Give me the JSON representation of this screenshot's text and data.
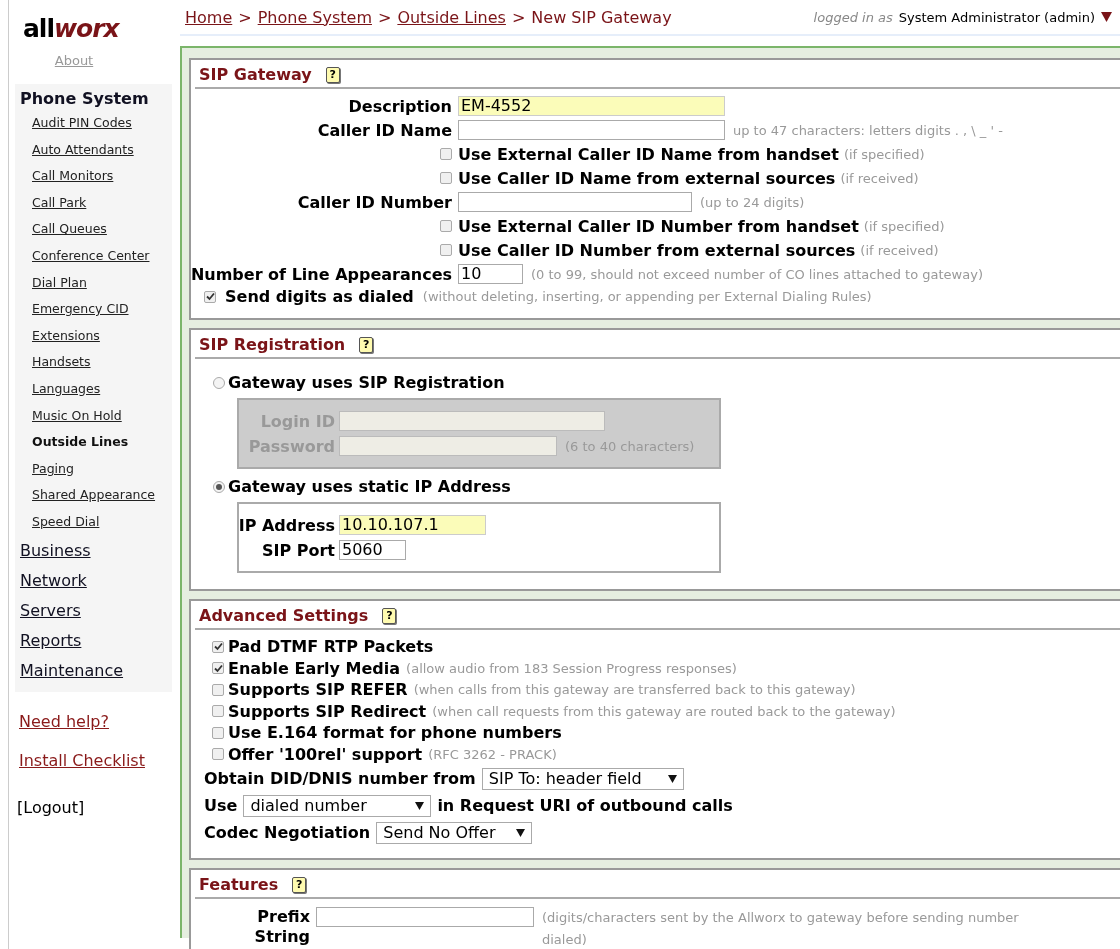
{
  "logo": {
    "dark": "all",
    "accent": "worx"
  },
  "about": "About",
  "sidebar": {
    "groups": [
      {
        "label": "Phone System",
        "expanded": true,
        "children": [
          {
            "label": "Audit PIN Codes",
            "selected": false
          },
          {
            "label": "Auto Attendants",
            "selected": false
          },
          {
            "label": "Call Monitors",
            "selected": false
          },
          {
            "label": "Call Park",
            "selected": false
          },
          {
            "label": "Call Queues",
            "selected": false
          },
          {
            "label": "Conference Center",
            "selected": false
          },
          {
            "label": "Dial Plan",
            "selected": false
          },
          {
            "label": "Emergency CID",
            "selected": false
          },
          {
            "label": "Extensions",
            "selected": false
          },
          {
            "label": "Handsets",
            "selected": false
          },
          {
            "label": "Languages",
            "selected": false
          },
          {
            "label": "Music On Hold",
            "selected": false
          },
          {
            "label": "Outside Lines",
            "selected": true
          },
          {
            "label": "Paging",
            "selected": false
          },
          {
            "label": "Shared Appearance",
            "selected": false
          },
          {
            "label": "Speed Dial",
            "selected": false
          }
        ]
      },
      {
        "label": "Business",
        "expanded": false
      },
      {
        "label": "Network",
        "expanded": false
      },
      {
        "label": "Servers",
        "expanded": false
      },
      {
        "label": "Reports",
        "expanded": false
      },
      {
        "label": "Maintenance",
        "expanded": false
      }
    ],
    "links": [
      "Need help?",
      "Install Checklist"
    ],
    "logout": "[Logout]"
  },
  "breadcrumb": [
    {
      "kind": "link",
      "text": "Home"
    },
    {
      "kind": "separator",
      "text": ">"
    },
    {
      "kind": "link",
      "text": "Phone System"
    },
    {
      "kind": "separator",
      "text": ">"
    },
    {
      "kind": "link",
      "text": "Outside Lines"
    },
    {
      "kind": "separator",
      "text": ">"
    },
    {
      "kind": "current",
      "text": "New SIP Gateway"
    }
  ],
  "user": {
    "prefix": "logged in as",
    "name": "System Administrator (admin)"
  },
  "sections": [
    {
      "title": "SIP Gateway",
      "help": "?",
      "rows": [
        {
          "kind": "field",
          "label": "Description",
          "value": "EM-4552",
          "required": true
        },
        {
          "kind": "field",
          "label": "Caller ID Name",
          "hint": "up to 47 characters: letters digits . , \\ _ ' -",
          "required": false
        },
        {
          "kind": "checkbox",
          "label": "Use External Caller ID Name from handset",
          "note": "(if specified)",
          "checked": false
        },
        {
          "kind": "checkbox",
          "label": "Use Caller ID Name from external sources",
          "note": "(if received)",
          "checked": false
        },
        {
          "kind": "field",
          "label": "Caller ID Number",
          "hint": "(up to 24 digits)",
          "required": false
        },
        {
          "kind": "checkbox",
          "label": "Use External Caller ID Number from handset",
          "note": "(if specified)",
          "checked": false
        },
        {
          "kind": "checkbox",
          "label": "Use Caller ID Number from external sources",
          "note": "(if received)",
          "checked": false
        },
        {
          "kind": "field",
          "label": "Number of Line Appearances",
          "value": "10",
          "hint": "(0 to 99, should not exceed number of CO lines attached to gateway)",
          "required": false
        },
        {
          "kind": "wide-checkbox",
          "label": "Send digits as dialed",
          "note": "(without deleting, inserting, or appending per External Dialing Rules)",
          "checked": true
        }
      ]
    },
    {
      "title": "SIP Registration",
      "help": "?",
      "options": [
        {
          "label": "Gateway uses SIP Registration",
          "selected": false,
          "disabled": true,
          "fields": [
            {
              "label": "Login ID"
            },
            {
              "label": "Password",
              "hint": "(6 to 40 characters)"
            }
          ]
        },
        {
          "label": "Gateway uses static IP Address",
          "selected": true,
          "disabled": false,
          "fields": [
            {
              "label": "IP Address",
              "value": "10.10.107.1",
              "required": true
            },
            {
              "label": "SIP Port",
              "value": "5060",
              "required": false
            }
          ]
        }
      ]
    },
    {
      "title": "Advanced Settings",
      "help": "?",
      "rows": [
        {
          "kind": "checkbox",
          "label": "Pad DTMF RTP Packets",
          "checked": true
        },
        {
          "kind": "checkbox",
          "label": "Enable Early Media",
          "note": "(allow audio from 183 Session Progress responses)",
          "checked": true
        },
        {
          "kind": "checkbox",
          "label": "Supports SIP REFER",
          "note": "(when calls from this gateway are transferred back to this gateway)",
          "checked": false
        },
        {
          "kind": "checkbox",
          "label": "Supports SIP Redirect",
          "note": "(when call requests from this gateway are routed back to the gateway)",
          "checked": false
        },
        {
          "kind": "checkbox",
          "label": "Use E.164 format for phone numbers",
          "checked": false
        },
        {
          "kind": "checkbox",
          "label": "Offer '100rel' support",
          "note": "(RFC 3262 - PRACK)",
          "checked": false
        },
        {
          "kind": "select",
          "label": "Obtain DID/DNIS number from",
          "value": "SIP To: header field"
        },
        {
          "kind": "select",
          "label": "Use",
          "value": "dialed number",
          "suffix": "in Request URI of outbound calls"
        },
        {
          "kind": "select",
          "label": "Codec Negotiation",
          "value": "Send No Offer"
        }
      ]
    },
    {
      "title": "Features",
      "help": "?",
      "rows": [
        {
          "kind": "field",
          "label": "Prefix String",
          "hint": "(digits/characters sent by the Allworx to gateway before sending number dialed)",
          "required": false
        }
      ]
    }
  ]
}
